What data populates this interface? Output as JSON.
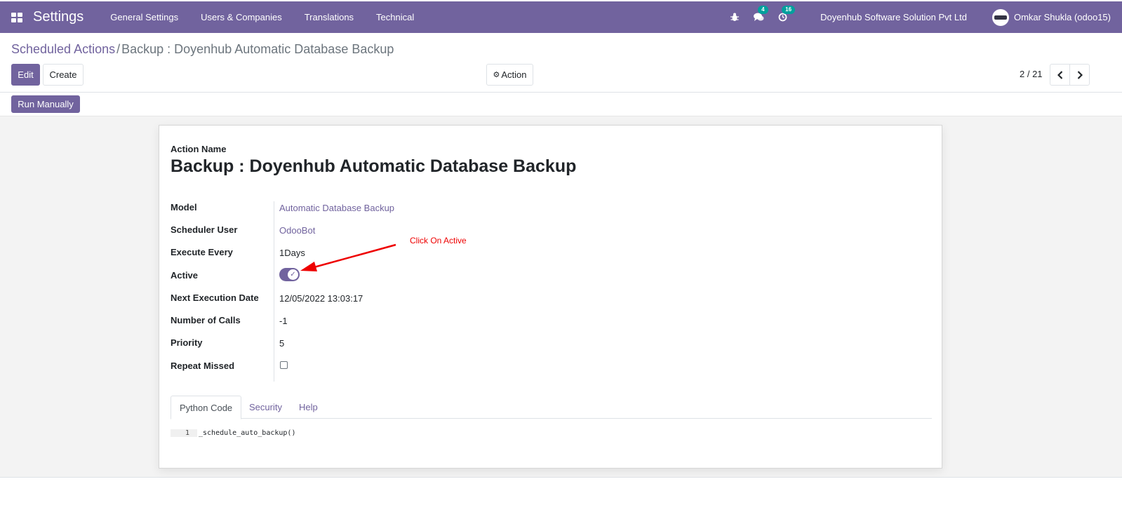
{
  "navbar": {
    "app_title": "Settings",
    "menu": [
      "General Settings",
      "Users & Companies",
      "Translations",
      "Technical"
    ],
    "messages_count": "4",
    "activities_count": "16",
    "company": "Doyenhub Software Solution Pvt Ltd",
    "user": "Omkar Shukla (odoo15)"
  },
  "breadcrumb": {
    "parent": "Scheduled Actions",
    "separator": "/",
    "current": "Backup : Doyenhub Automatic Database Backup"
  },
  "buttons": {
    "edit": "Edit",
    "create": "Create",
    "action": "Action",
    "run_manually": "Run Manually"
  },
  "pager": {
    "value": "2 / 21"
  },
  "form": {
    "name_label": "Action Name",
    "name": "Backup : Doyenhub Automatic Database Backup",
    "fields": [
      {
        "label": "Model",
        "value": "Automatic Database Backup"
      },
      {
        "label": "Scheduler User",
        "value": "OdooBot"
      },
      {
        "label": "Execute Every",
        "value": "1Days"
      },
      {
        "label": "Active",
        "value": ""
      },
      {
        "label": "Next Execution Date",
        "value": "12/05/2022 13:03:17"
      },
      {
        "label": "Number of Calls",
        "value": "-1"
      },
      {
        "label": "Priority",
        "value": "5"
      },
      {
        "label": "Repeat Missed",
        "value": ""
      }
    ],
    "active": true,
    "repeat_missed": false
  },
  "annotation": "Click On Active",
  "tabs": [
    "Python Code",
    "Security",
    "Help"
  ],
  "code": {
    "line_number": "1",
    "text": "_schedule_auto_backup()"
  },
  "colors": {
    "brand": "#71639e",
    "badge": "#00a09d",
    "annotation": "#ee0000"
  }
}
